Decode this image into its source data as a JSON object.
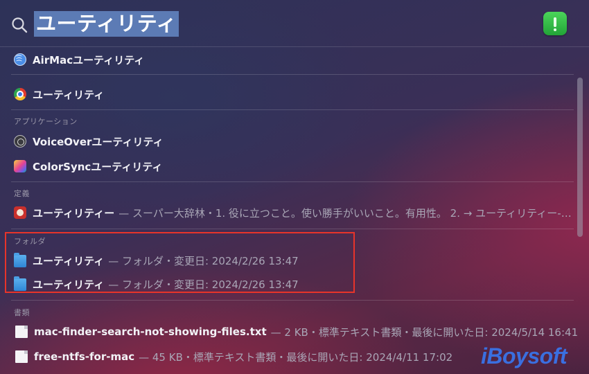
{
  "search": {
    "query": "ユーティリティ",
    "icon": "search-icon",
    "app_icon": "system-information-app-icon"
  },
  "results": {
    "top_hits": [
      {
        "title": "AirMacユーティリティ",
        "icon": "airmac-utility-icon"
      }
    ],
    "best": [
      {
        "title": "ユーティリティ",
        "icon": "chrome-icon"
      }
    ],
    "applications": {
      "header": "アプリケーション",
      "items": [
        {
          "title": "VoiceOverユーティリティ",
          "icon": "voiceover-utility-icon"
        },
        {
          "title": "ColorSyncユーティリティ",
          "icon": "colorsync-utility-icon"
        }
      ]
    },
    "definitions": {
      "header": "定義",
      "items": [
        {
          "title": "ユーティリティー",
          "meta": "— スーパー大辞林・1. 役に立つこと。使い勝手がいいこと。有用性。 2. → ユーティリティー-…",
          "icon": "dictionary-icon"
        }
      ]
    },
    "folders": {
      "header": "フォルダ",
      "items": [
        {
          "title": "ユーティリティ",
          "meta": "— フォルダ・変更日: 2024/2/26 13:47",
          "icon": "folder-icon"
        },
        {
          "title": "ユーティリティ",
          "meta": "— フォルダ・変更日: 2024/2/26 13:47",
          "icon": "folder-icon"
        }
      ]
    },
    "documents": {
      "header": "書類",
      "items": [
        {
          "title": "mac-finder-search-not-showing-files.txt",
          "meta": "— 2 KB・標準テキスト書類・最後に開いた日: 2024/5/14 16:41",
          "icon": "text-file-icon"
        },
        {
          "title": "free-ntfs-for-mac",
          "meta": "— 45 KB・標準テキスト書類・最後に開いた日: 2024/4/11 17:02",
          "icon": "text-file-icon"
        }
      ]
    }
  },
  "watermark": "iBoysoft",
  "colors": {
    "selection": "#5c7bb5",
    "highlight_box": "#e8342a",
    "watermark": "#3a6fe0"
  }
}
